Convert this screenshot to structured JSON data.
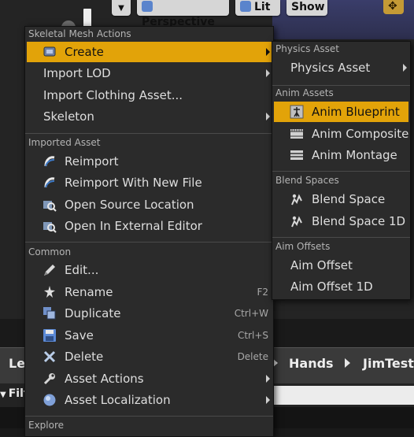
{
  "viewport_toolbar": {
    "perspective": "Perspective",
    "lit": "Lit",
    "show": "Show"
  },
  "main_menu": {
    "sections": {
      "skeletal": "Skeletal Mesh Actions",
      "imported": "Imported Asset",
      "common": "Common",
      "explore": "Explore"
    },
    "items": {
      "create": "Create",
      "import_lod": "Import LOD",
      "import_clothing": "Import Clothing Asset...",
      "skeleton": "Skeleton",
      "reimport": "Reimport",
      "reimport_new": "Reimport With New File",
      "open_source": "Open Source Location",
      "open_external": "Open In External Editor",
      "edit": "Edit...",
      "rename": "Rename",
      "duplicate": "Duplicate",
      "save": "Save",
      "delete": "Delete",
      "asset_actions": "Asset Actions",
      "asset_localization": "Asset Localization"
    },
    "shortcuts": {
      "rename": "F2",
      "duplicate": "Ctrl+W",
      "save": "Ctrl+S",
      "delete": "Delete"
    }
  },
  "sub_menu": {
    "sections": {
      "physics": "Physics Asset",
      "anim": "Anim Assets",
      "blend": "Blend Spaces",
      "aim": "Aim Offsets"
    },
    "items": {
      "physics_asset": "Physics Asset",
      "anim_blueprint": "Anim Blueprint",
      "anim_composite": "Anim Composite",
      "anim_montage": "Anim Montage",
      "blend_space": "Blend Space",
      "blend_space_1d": "Blend Space 1D",
      "aim_offset": "Aim Offset",
      "aim_offset_1d": "Aim Offset 1D"
    }
  },
  "breadcrumb": {
    "left": "Le",
    "hands": "Hands",
    "jimtest": "JimTest"
  },
  "filter": {
    "label": "Filt"
  },
  "colors": {
    "highlight": "#e2a309",
    "menu_bg": "#2b2b2b"
  }
}
